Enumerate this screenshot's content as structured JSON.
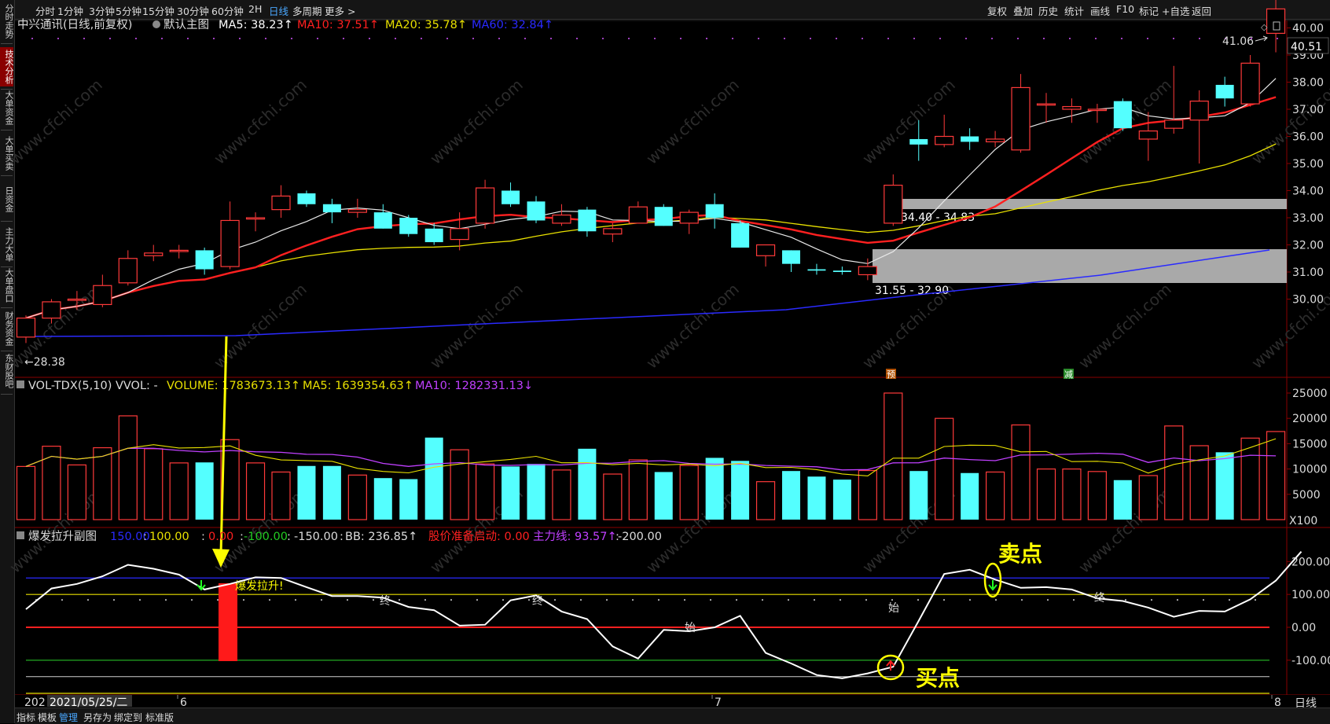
{
  "sidebar": {
    "tabs": [
      {
        "label": "分时走势",
        "active": false
      },
      {
        "label": "技术分析",
        "active": true
      },
      {
        "label": "大单资金",
        "active": false
      },
      {
        "label": "大单买卖",
        "active": false
      },
      {
        "label": "日资金",
        "active": false
      },
      {
        "label": "主力大单",
        "active": false
      },
      {
        "label": "大单盘口",
        "active": false
      },
      {
        "label": "财务资金",
        "active": false
      },
      {
        "label": "东财股吧",
        "active": false
      }
    ]
  },
  "toolbar": {
    "periods": [
      "分时",
      "1分钟",
      "3分钟",
      "5分钟",
      "15分钟",
      "30分钟",
      "60分钟",
      "2H",
      "日线",
      "多周期",
      "更多 >"
    ],
    "active_period": "日线",
    "right_items": [
      "复权",
      "叠加",
      "历史",
      "统计",
      "画线",
      "F10",
      "标记",
      "+自选",
      "返回"
    ]
  },
  "price_panel": {
    "stock": "中兴通讯(日线,前复权)",
    "template": "默认主图",
    "ma5": "MA5: 38.23↑",
    "ma10": "MA10: 37.51↑",
    "ma20": "MA20: 35.78↑",
    "ma60": "MA60: 32.84↑",
    "high_label": "41.06",
    "low_label": "←28.38",
    "zone_upper_label": "34.40 - 34.83",
    "zone_lower_label": "31.55 - 32.90",
    "marker_yu": "预",
    "marker_jian": "减",
    "price_ticks": [
      "40.00",
      "39.00",
      "38.00",
      "37.00",
      "36.00",
      "35.00",
      "34.00",
      "33.00",
      "32.00",
      "31.00",
      "30.00"
    ],
    "current_price": "40.51"
  },
  "volume_panel": {
    "name": "VOL-TDX(5,10) VVOL: -",
    "volume": "VOLUME: 1783673.13↑",
    "ma5": "MA5: 1639354.63↑",
    "ma10": "MA10: 1282331.13↓",
    "ticks": [
      "25000",
      "20000",
      "15000",
      "10000",
      "5000"
    ],
    "unit": "X100"
  },
  "indicator_panel": {
    "name": "爆发拉升副图",
    "level_150": "150.00",
    "level_100": "100.00",
    "level_0": "0.00",
    "level_m100": "-100.00",
    "level_m150": "-150.00",
    "bb": "BB: 236.85↑",
    "signal": "股价准备启动: 0.00",
    "main_line": "主力线: 93.57↑",
    "level_m200": "-200.00",
    "ticks": [
      "200.00",
      "100.00",
      "0.00",
      "-100.00"
    ],
    "surge_text": "爆发拉升!",
    "markers": [
      "终",
      "终",
      "始",
      "始",
      "终"
    ],
    "sell_label": "卖点",
    "buy_label": "买点"
  },
  "date_axis": {
    "date": "2021/05/25/二",
    "date_prefix": "202",
    "months": [
      "6",
      "7",
      "8"
    ],
    "right_label": "日线"
  },
  "bottom_bar": {
    "items": [
      "指标",
      "模板",
      "管理",
      "另存为",
      "绑定到",
      "标准版"
    ],
    "active": "管理"
  },
  "watermark": "www.cfchi.com",
  "colors": {
    "up": "#ff3a3a",
    "down": "#54ffff",
    "ma5": "#e8e8e8",
    "ma10": "#ff2020",
    "ma20": "#e8e000",
    "ma60": "#2a2aff",
    "vol_ma10": "#c040ff",
    "annotation": "#ffff00",
    "active_tab": "#4aa8ff"
  },
  "chart_data": {
    "type": "candlestick",
    "candles": [
      {
        "o": 28.6,
        "h": 29.4,
        "l": 28.38,
        "c": 29.3
      },
      {
        "o": 29.3,
        "h": 30.0,
        "l": 29.1,
        "c": 29.9
      },
      {
        "o": 30.0,
        "h": 30.3,
        "l": 29.6,
        "c": 30.0
      },
      {
        "o": 29.8,
        "h": 30.9,
        "l": 29.7,
        "c": 30.5
      },
      {
        "o": 30.6,
        "h": 31.8,
        "l": 30.5,
        "c": 31.5
      },
      {
        "o": 31.6,
        "h": 32.0,
        "l": 31.4,
        "c": 31.7
      },
      {
        "o": 31.8,
        "h": 32.0,
        "l": 31.5,
        "c": 31.8
      },
      {
        "o": 31.8,
        "h": 31.9,
        "l": 30.9,
        "c": 31.1
      },
      {
        "o": 31.2,
        "h": 33.6,
        "l": 31.1,
        "c": 32.9
      },
      {
        "o": 33.0,
        "h": 33.2,
        "l": 32.5,
        "c": 33.0
      },
      {
        "o": 33.3,
        "h": 34.2,
        "l": 33.0,
        "c": 33.8
      },
      {
        "o": 33.9,
        "h": 34.0,
        "l": 33.4,
        "c": 33.5
      },
      {
        "o": 33.5,
        "h": 33.7,
        "l": 32.8,
        "c": 33.2
      },
      {
        "o": 33.2,
        "h": 33.7,
        "l": 33.0,
        "c": 33.3
      },
      {
        "o": 33.2,
        "h": 33.5,
        "l": 32.6,
        "c": 32.6
      },
      {
        "o": 33.0,
        "h": 33.1,
        "l": 32.3,
        "c": 32.4
      },
      {
        "o": 32.6,
        "h": 32.8,
        "l": 32.0,
        "c": 32.1
      },
      {
        "o": 32.2,
        "h": 33.2,
        "l": 31.8,
        "c": 32.6
      },
      {
        "o": 32.8,
        "h": 34.4,
        "l": 32.6,
        "c": 34.1
      },
      {
        "o": 34.0,
        "h": 34.3,
        "l": 33.4,
        "c": 33.5
      },
      {
        "o": 33.6,
        "h": 33.8,
        "l": 32.8,
        "c": 32.9
      },
      {
        "o": 32.8,
        "h": 33.5,
        "l": 32.7,
        "c": 33.1
      },
      {
        "o": 33.3,
        "h": 33.4,
        "l": 32.3,
        "c": 32.5
      },
      {
        "o": 32.4,
        "h": 32.8,
        "l": 32.1,
        "c": 32.6
      },
      {
        "o": 32.8,
        "h": 33.6,
        "l": 32.8,
        "c": 33.4
      },
      {
        "o": 33.4,
        "h": 33.5,
        "l": 32.7,
        "c": 32.7
      },
      {
        "o": 32.8,
        "h": 33.3,
        "l": 32.4,
        "c": 33.2
      },
      {
        "o": 33.5,
        "h": 33.9,
        "l": 32.6,
        "c": 33.0
      },
      {
        "o": 32.8,
        "h": 32.9,
        "l": 31.9,
        "c": 31.9
      },
      {
        "o": 31.6,
        "h": 32.0,
        "l": 31.2,
        "c": 32.0
      },
      {
        "o": 31.8,
        "h": 31.8,
        "l": 31.0,
        "c": 31.3
      },
      {
        "o": 31.1,
        "h": 31.3,
        "l": 30.9,
        "c": 31.05
      },
      {
        "o": 31.05,
        "h": 31.2,
        "l": 30.9,
        "c": 31.0
      },
      {
        "o": 30.9,
        "h": 31.5,
        "l": 30.7,
        "c": 31.2
      },
      {
        "o": 32.8,
        "h": 34.6,
        "l": 32.7,
        "c": 34.2
      },
      {
        "o": 35.9,
        "h": 36.6,
        "l": 35.1,
        "c": 35.7
      },
      {
        "o": 35.7,
        "h": 36.8,
        "l": 35.6,
        "c": 36.0
      },
      {
        "o": 36.0,
        "h": 36.3,
        "l": 35.5,
        "c": 35.8
      },
      {
        "o": 35.8,
        "h": 36.2,
        "l": 35.6,
        "c": 35.9
      },
      {
        "o": 35.5,
        "h": 38.3,
        "l": 35.4,
        "c": 37.8
      },
      {
        "o": 37.2,
        "h": 37.6,
        "l": 36.5,
        "c": 37.2
      },
      {
        "o": 37.0,
        "h": 37.4,
        "l": 36.5,
        "c": 37.1
      },
      {
        "o": 37.0,
        "h": 37.2,
        "l": 36.5,
        "c": 37.0
      },
      {
        "o": 37.3,
        "h": 37.4,
        "l": 36.2,
        "c": 36.3
      },
      {
        "o": 35.9,
        "h": 36.9,
        "l": 35.1,
        "c": 36.2
      },
      {
        "o": 36.3,
        "h": 38.6,
        "l": 36.1,
        "c": 36.6
      },
      {
        "o": 36.6,
        "h": 37.7,
        "l": 35.0,
        "c": 37.3
      },
      {
        "o": 37.9,
        "h": 38.2,
        "l": 37.1,
        "c": 37.4
      },
      {
        "o": 37.2,
        "h": 39.0,
        "l": 37.1,
        "c": 38.7
      },
      {
        "o": 39.8,
        "h": 41.06,
        "l": 39.1,
        "c": 40.7
      }
    ],
    "volume": [
      10500,
      14500,
      10800,
      14200,
      20500,
      14000,
      11200,
      11300,
      15800,
      11200,
      9400,
      10600,
      10600,
      8800,
      8200,
      8000,
      16200,
      13800,
      11000,
      10500,
      11000,
      9800,
      14000,
      9000,
      11800,
      9400,
      10700,
      12200,
      11600,
      7500,
      9600,
      8500,
      7900,
      9700,
      25000,
      9600,
      20000,
      9200,
      9400,
      18700,
      10000,
      10000,
      9500,
      7800,
      8700,
      18500,
      14600,
      13300,
      16100,
      17400
    ],
    "indicator_line": [
      55,
      118,
      132,
      155,
      190,
      178,
      160,
      115,
      132,
      152,
      150,
      122,
      95,
      95,
      90,
      62,
      52,
      5,
      8,
      82,
      97,
      48,
      25,
      -58,
      -95,
      -8,
      -12,
      0,
      35,
      -78,
      -110,
      -145,
      -155,
      -140,
      -120,
      20,
      162,
      175,
      145,
      120,
      122,
      115,
      88,
      80,
      60,
      32,
      50,
      48,
      85,
      142,
      230
    ]
  }
}
